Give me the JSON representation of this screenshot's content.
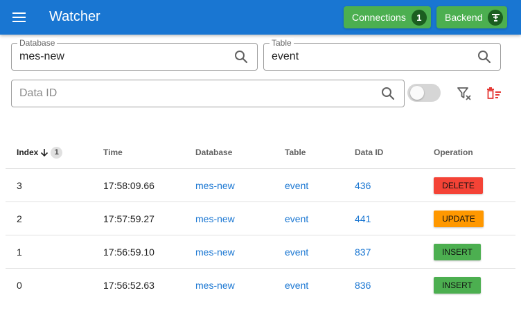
{
  "app": {
    "title": "Watcher",
    "connections_label": "Connections",
    "connections_count": "1",
    "backend_label": "Backend"
  },
  "filters": {
    "database": {
      "legend": "Database",
      "value": "mes-new"
    },
    "table": {
      "legend": "Table",
      "value": "event"
    },
    "data_id": {
      "placeholder": "Data ID"
    }
  },
  "table": {
    "headers": {
      "index": "Index",
      "index_sort_badge": "1",
      "time": "Time",
      "database": "Database",
      "table": "Table",
      "data_id": "Data ID",
      "operation": "Operation"
    },
    "rows": [
      {
        "index": "3",
        "time": "17:58:09.66",
        "database": "mes-new",
        "table": "event",
        "data_id": "436",
        "operation": "DELETE"
      },
      {
        "index": "2",
        "time": "17:57:59.27",
        "database": "mes-new",
        "table": "event",
        "data_id": "441",
        "operation": "UPDATE"
      },
      {
        "index": "1",
        "time": "17:56:59.10",
        "database": "mes-new",
        "table": "event",
        "data_id": "837",
        "operation": "INSERT"
      },
      {
        "index": "0",
        "time": "17:56:52.63",
        "database": "mes-new",
        "table": "event",
        "data_id": "836",
        "operation": "INSERT"
      }
    ]
  },
  "colors": {
    "appbar": "#1976d2",
    "success": "#4caf50",
    "success_dark": "#1b5e20",
    "delete": "#f44336",
    "update": "#ff9800",
    "insert": "#4caf50",
    "link": "#1976d2",
    "danger_icon": "#e53935"
  },
  "icons": {
    "menu": "menu-icon",
    "backend": "server-icon",
    "search": "search-icon",
    "filter_clear": "filter-remove-icon",
    "delete_all": "delete-sweep-icon",
    "sort": "arrow-down-icon"
  }
}
